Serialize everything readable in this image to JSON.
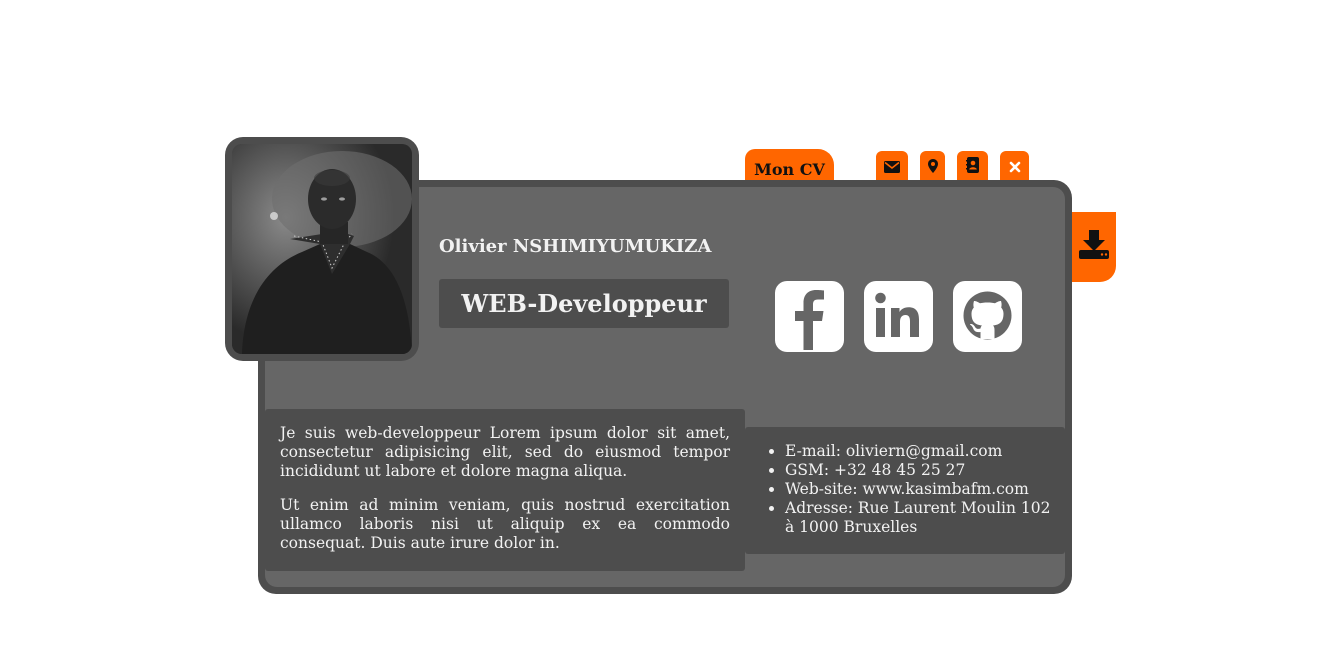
{
  "profile": {
    "name": "Olivier NSHIMIYUMUKIZA",
    "job_title": "WEB-Developpeur"
  },
  "tabs": {
    "cv_label": "Mon CV",
    "icons": [
      "envelope-icon",
      "map-pin-icon",
      "address-book-icon",
      "close-icon"
    ]
  },
  "download": {
    "icon": "download-icon"
  },
  "social": [
    "facebook-icon",
    "linkedin-icon",
    "github-icon"
  ],
  "bio": {
    "paragraph1": "Je suis web-developpeur Lorem ipsum dolor sit amet, consectetur adipisicing elit, sed do eiusmod tempor incididunt ut labore et dolore magna aliqua.",
    "paragraph2": "Ut enim ad minim veniam, quis nostrud exercitation ullamco laboris nisi ut aliquip ex ea commodo consequat. Duis aute irure dolor in."
  },
  "contact": {
    "items": [
      "E-mail: oliviern@gmail.com",
      "GSM: +32 48 45 25 27",
      "Web-site: www.kasimbafm.com",
      "Adresse: Rue Laurent Moulin 102 à 1000 Bruxelles"
    ]
  },
  "colors": {
    "accent": "#ff6600",
    "card_dark": "#4d4d4d",
    "card_mid": "#666666",
    "text": "#f2f2f2"
  }
}
